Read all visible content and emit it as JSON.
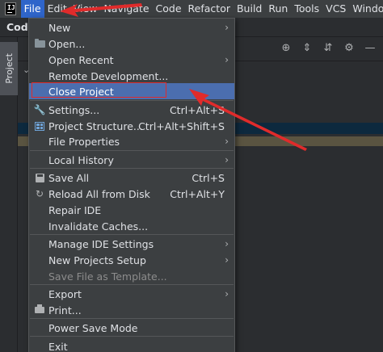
{
  "menubar": {
    "app_logo": "IJ",
    "items": [
      "File",
      "Edit",
      "View",
      "Navigate",
      "Code",
      "Refactor",
      "Build",
      "Run",
      "Tools",
      "VCS",
      "Windo"
    ]
  },
  "background": {
    "breadcrumb": "Code",
    "project_tab": "Project"
  },
  "file_menu": {
    "items": [
      {
        "label": "New",
        "shortcut": "",
        "submenu": true,
        "icon": ""
      },
      {
        "label": "Open...",
        "shortcut": "",
        "submenu": false,
        "icon": "folder-icon"
      },
      {
        "label": "Open Recent",
        "shortcut": "",
        "submenu": true,
        "icon": ""
      },
      {
        "label": "Remote Development...",
        "shortcut": "",
        "submenu": false,
        "icon": ""
      },
      {
        "label": "Close Project",
        "shortcut": "",
        "submenu": false,
        "icon": "",
        "selected": true
      },
      {
        "label": "Settings...",
        "shortcut": "Ctrl+Alt+S",
        "submenu": false,
        "icon": "wrench-icon"
      },
      {
        "label": "Project Structure...",
        "shortcut": "Ctrl+Alt+Shift+S",
        "submenu": false,
        "icon": "project-structure-icon"
      },
      {
        "label": "File Properties",
        "shortcut": "",
        "submenu": true,
        "icon": ""
      },
      {
        "label": "Local History",
        "shortcut": "",
        "submenu": true,
        "icon": ""
      },
      {
        "label": "Save All",
        "shortcut": "Ctrl+S",
        "submenu": false,
        "icon": "save-icon"
      },
      {
        "label": "Reload All from Disk",
        "shortcut": "Ctrl+Alt+Y",
        "submenu": false,
        "icon": "reload-icon"
      },
      {
        "label": "Repair IDE",
        "shortcut": "",
        "submenu": false,
        "icon": ""
      },
      {
        "label": "Invalidate Caches...",
        "shortcut": "",
        "submenu": false,
        "icon": ""
      },
      {
        "label": "Manage IDE Settings",
        "shortcut": "",
        "submenu": true,
        "icon": ""
      },
      {
        "label": "New Projects Setup",
        "shortcut": "",
        "submenu": true,
        "icon": ""
      },
      {
        "label": "Save File as Template...",
        "shortcut": "",
        "submenu": false,
        "icon": "",
        "disabled": true
      },
      {
        "label": "Export",
        "shortcut": "",
        "submenu": true,
        "icon": ""
      },
      {
        "label": "Print...",
        "shortcut": "",
        "submenu": false,
        "icon": "print-icon"
      },
      {
        "label": "Power Save Mode",
        "shortcut": "",
        "submenu": false,
        "icon": ""
      },
      {
        "label": "Exit",
        "shortcut": "",
        "submenu": false,
        "icon": ""
      }
    ]
  },
  "colors": {
    "menu_bg": "#3c3f41",
    "active_menu": "#2f65ca",
    "selected_item": "#4b6eaf",
    "annotation_red": "#e02b2b"
  }
}
